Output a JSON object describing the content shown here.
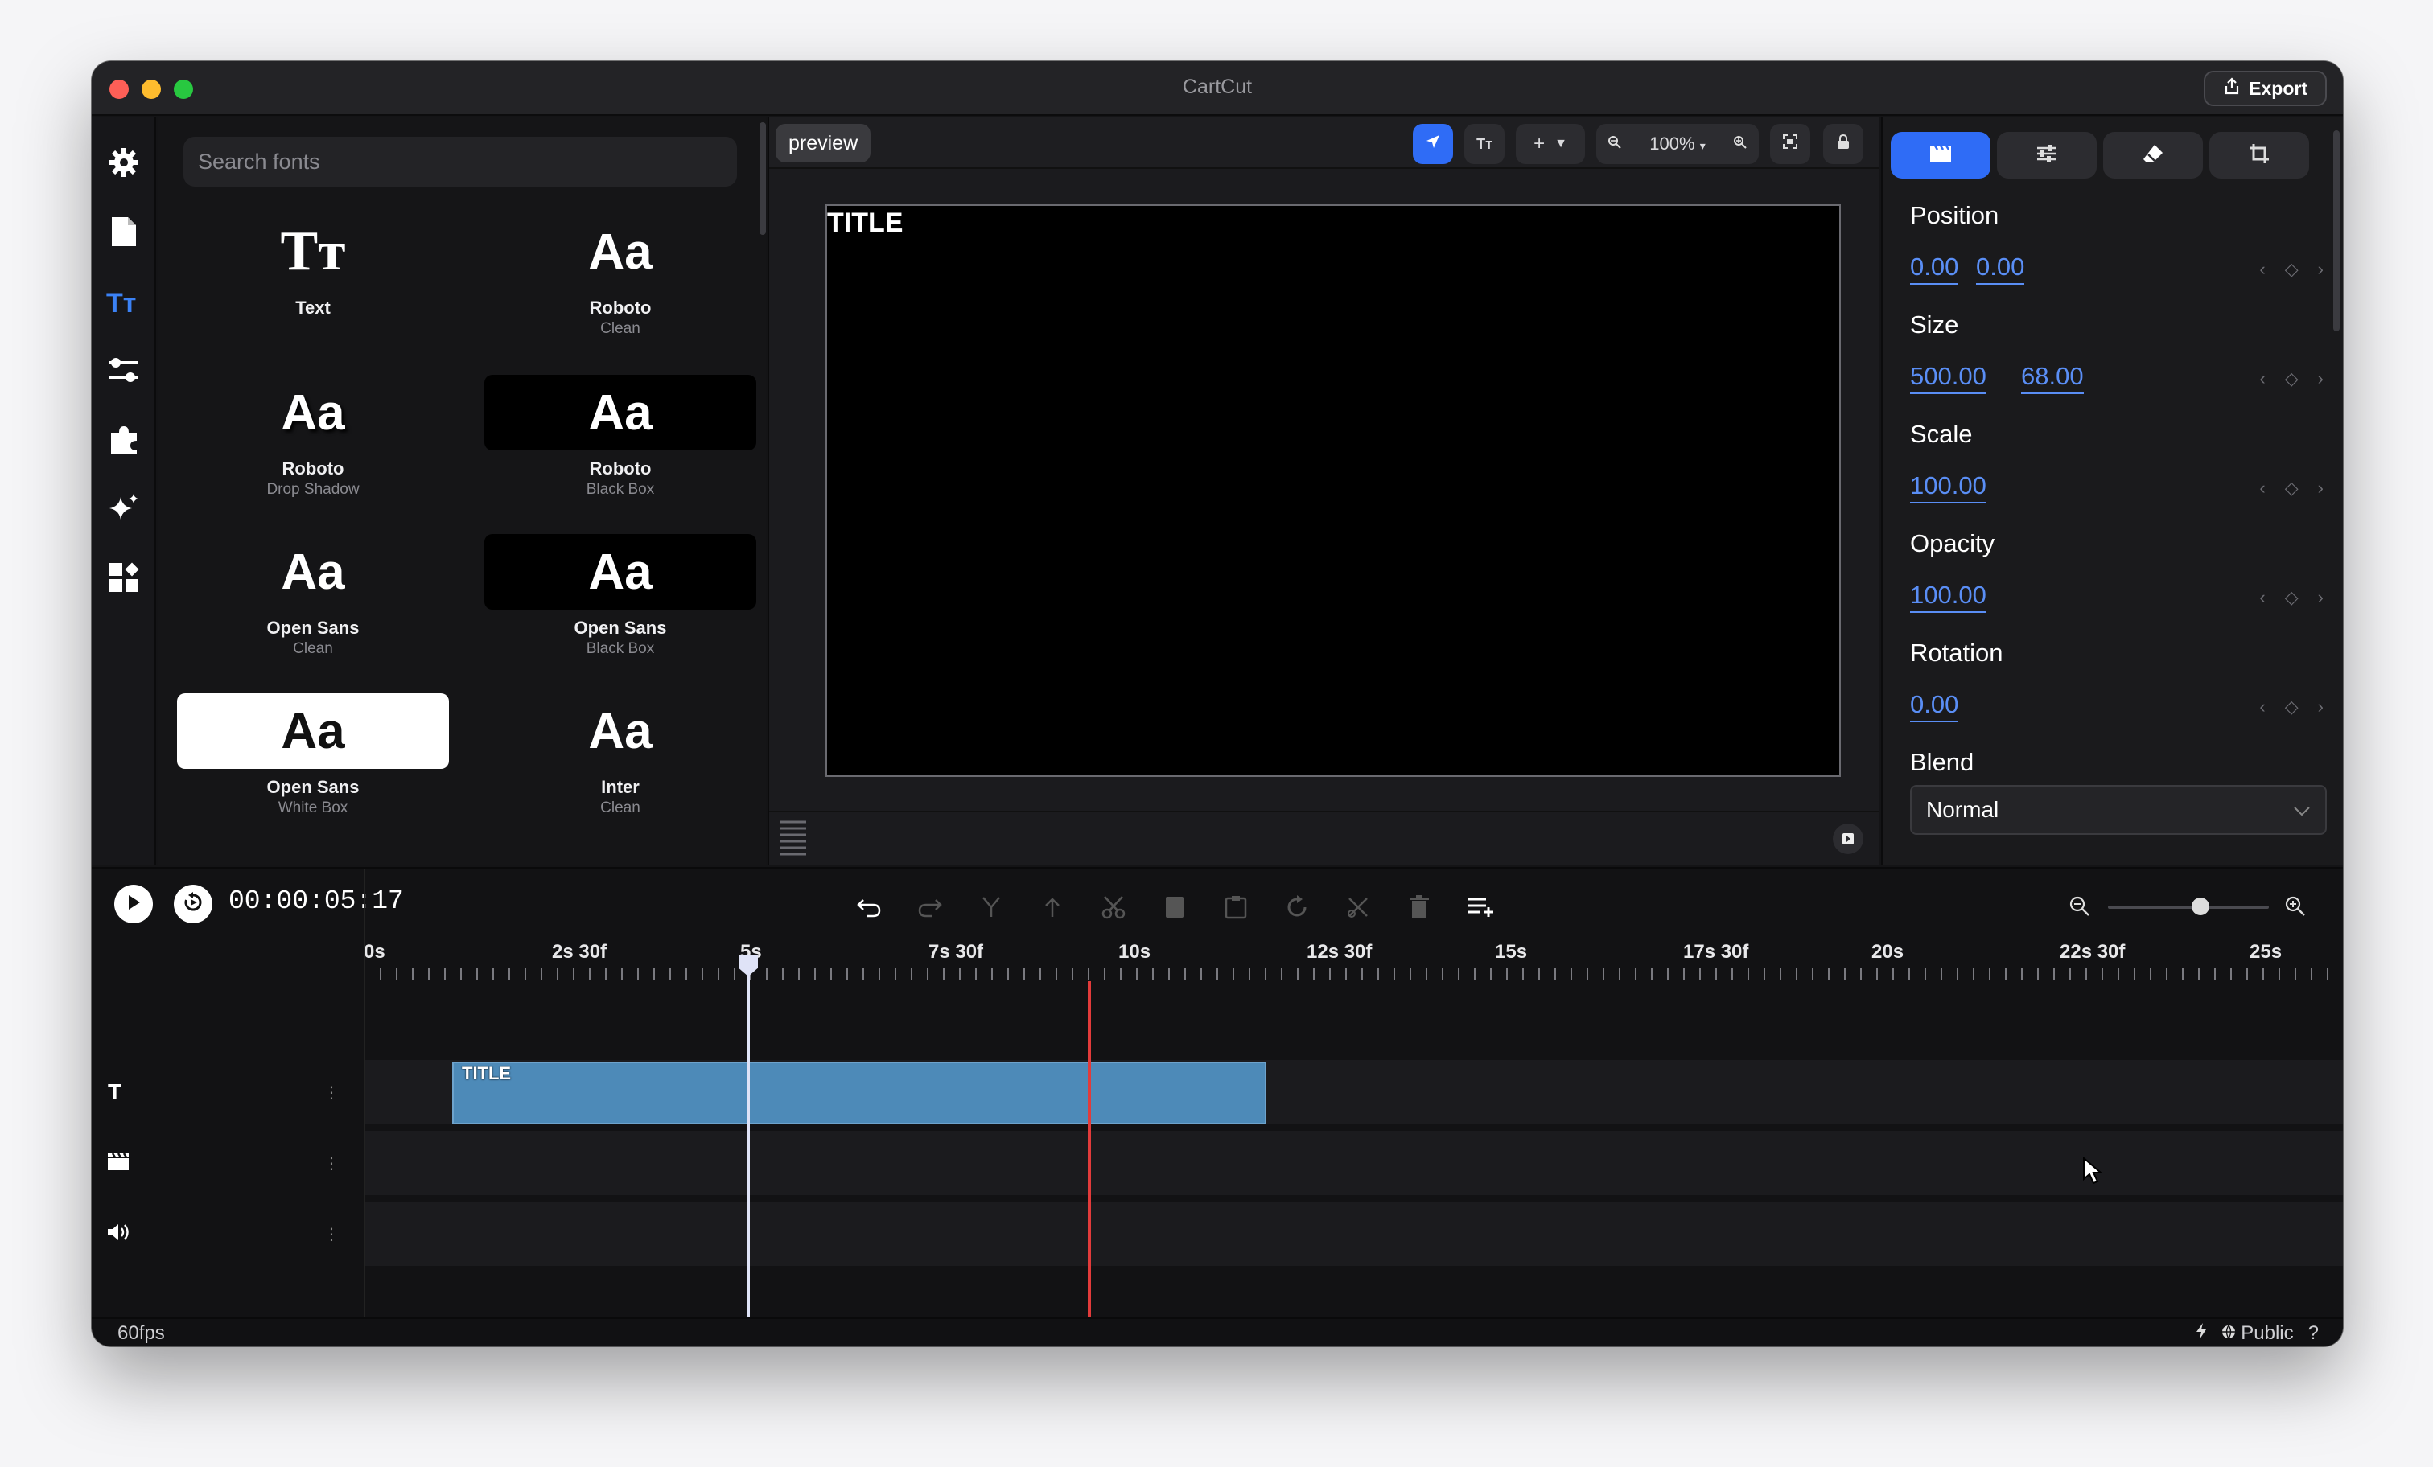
{
  "window": {
    "title": "CartCut",
    "export_label": "Export"
  },
  "rail": {
    "items": [
      {
        "icon": "gear-icon"
      },
      {
        "icon": "document-icon"
      },
      {
        "icon": "text-icon",
        "active": true
      },
      {
        "icon": "sliders-icon"
      },
      {
        "icon": "puzzle-icon"
      },
      {
        "icon": "sparkles-icon"
      },
      {
        "icon": "widgets-icon"
      }
    ]
  },
  "fonts": {
    "search_placeholder": "Search fonts",
    "tiles": [
      {
        "glyph": "Tт",
        "name": "Text",
        "sub": "",
        "style": "plain"
      },
      {
        "glyph": "Aa",
        "name": "Roboto",
        "sub": "Clean",
        "style": "plain"
      },
      {
        "glyph": "Aa",
        "name": "Roboto",
        "sub": "Drop Shadow",
        "style": "plain"
      },
      {
        "glyph": "Aa",
        "name": "Roboto",
        "sub": "Black Box",
        "style": "black"
      },
      {
        "glyph": "Aa",
        "name": "Open Sans",
        "sub": "Clean",
        "style": "plain"
      },
      {
        "glyph": "Aa",
        "name": "Open Sans",
        "sub": "Black Box",
        "style": "black"
      },
      {
        "glyph": "Aa",
        "name": "Open Sans",
        "sub": "White Box",
        "style": "white"
      },
      {
        "glyph": "Aa",
        "name": "Inter",
        "sub": "Clean",
        "style": "plain"
      }
    ]
  },
  "preview": {
    "tag": "preview",
    "zoom": "100%",
    "canvas_text": "TITLE"
  },
  "properties": {
    "position": {
      "label": "Position",
      "x": "0.00",
      "y": "0.00"
    },
    "size": {
      "label": "Size",
      "w": "500.00",
      "h": "68.00"
    },
    "scale": {
      "label": "Scale",
      "value": "100.00"
    },
    "opacity": {
      "label": "Opacity",
      "value": "100.00"
    },
    "rotation": {
      "label": "Rotation",
      "value": "0.00"
    },
    "blend": {
      "label": "Blend",
      "value": "Normal"
    }
  },
  "timeline": {
    "timecode": "00:00:05:17",
    "ruler": [
      "0s",
      "2s 30f",
      "5s",
      "7s 30f",
      "10s",
      "12s 30f",
      "15s",
      "17s 30f",
      "20s",
      "22s 30f",
      "25s"
    ],
    "clip_label": "TITLE",
    "tracks": [
      {
        "icon": "text-track-icon",
        "label": "T"
      },
      {
        "icon": "video-track-icon"
      },
      {
        "icon": "audio-track-icon"
      }
    ]
  },
  "status": {
    "fps": "60fps",
    "visibility": "Public",
    "help": "?"
  },
  "colors": {
    "accent": "#2f6cf6",
    "clip": "#4d8ab8",
    "marker": "#e23b3b"
  }
}
